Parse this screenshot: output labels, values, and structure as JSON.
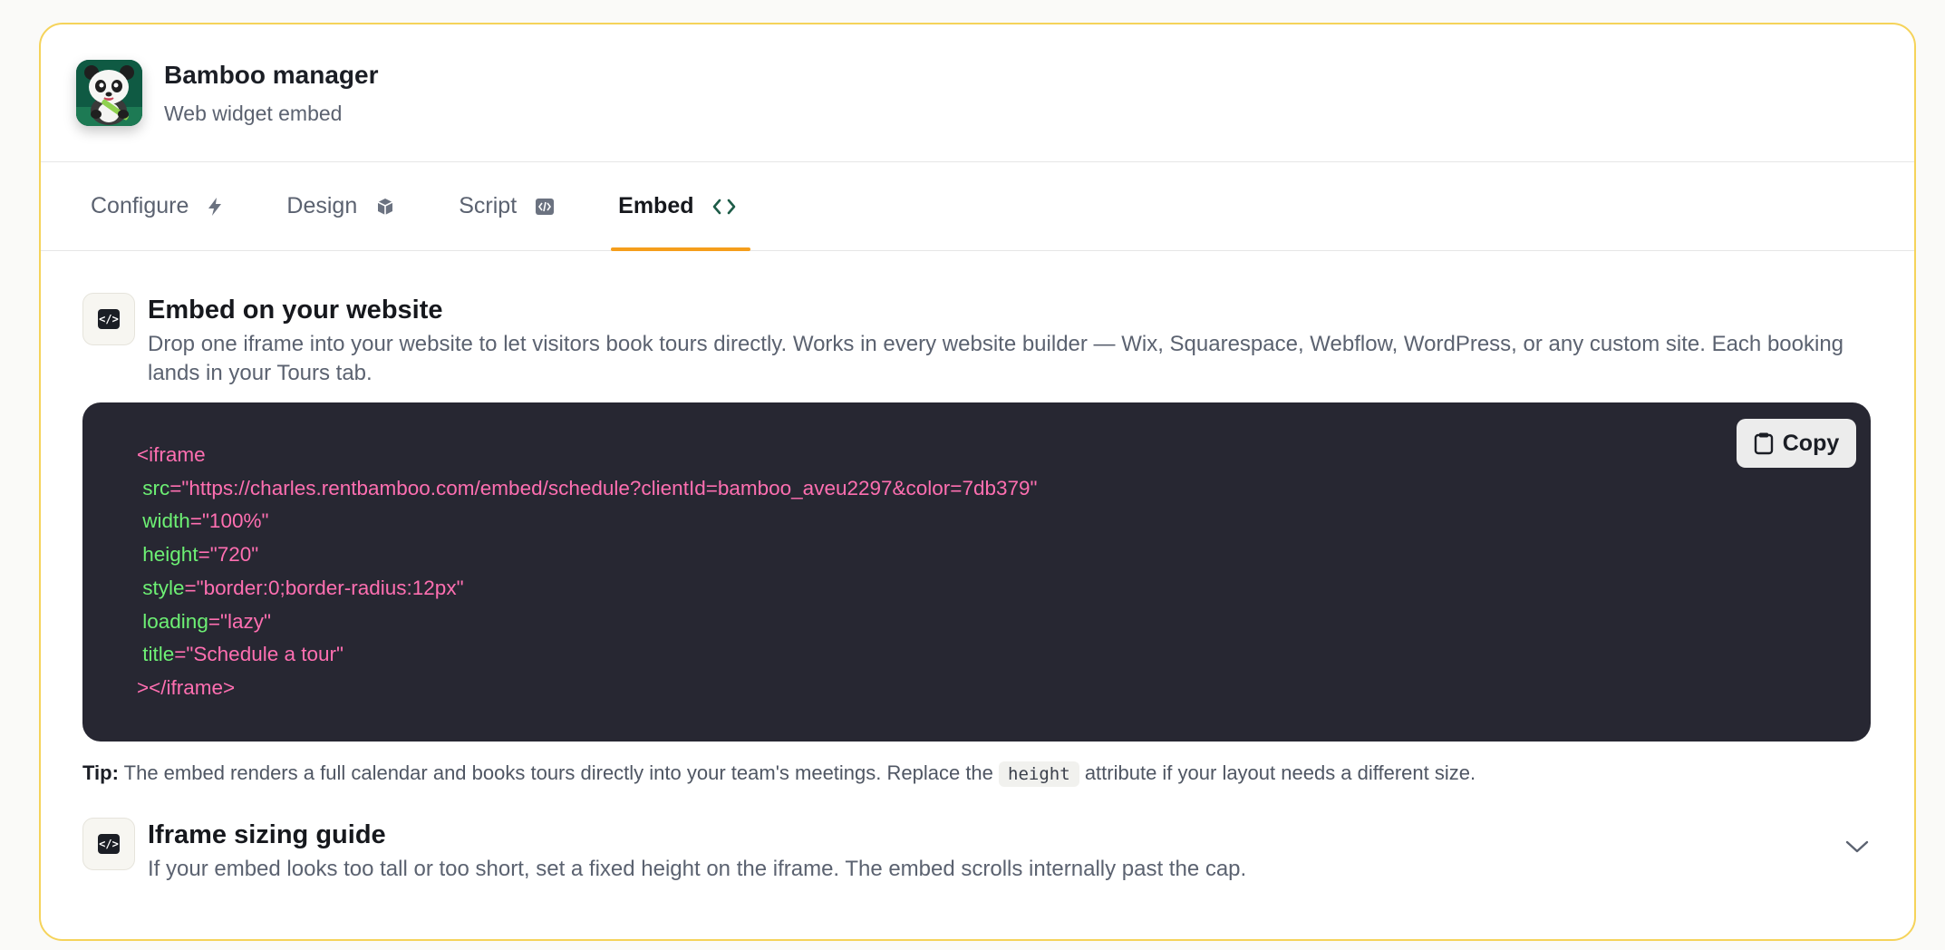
{
  "app": {
    "title": "Bamboo manager",
    "subtitle": "Web widget embed",
    "logo_icon": "panda-logo-icon"
  },
  "tabs": [
    {
      "label": "Configure",
      "icon": "bolt-icon",
      "active": false
    },
    {
      "label": "Design",
      "icon": "cube-icon",
      "active": false
    },
    {
      "label": "Script",
      "icon": "code-file-icon",
      "active": false
    },
    {
      "label": "Embed",
      "icon": "code-brackets-icon",
      "active": true
    }
  ],
  "embed": {
    "title": "Embed on your website",
    "description": "Drop one iframe into your website to let visitors book tours directly. Works in every website builder — Wix, Squarespace, Webflow, WordPress, or any custom site. Each booking lands in your Tours tab.",
    "copy_label": "Copy",
    "code": {
      "open_tag": "<iframe",
      "attrs": [
        {
          "name": "src",
          "value": "\"https://charles.rentbamboo.com/embed/schedule?clientId=bamboo_aveu2297&color=7db379\""
        },
        {
          "name": "width",
          "value": "\"100%\""
        },
        {
          "name": "height",
          "value": "\"720\""
        },
        {
          "name": "style",
          "value": "\"border:0;border-radius:12px\""
        },
        {
          "name": "loading",
          "value": "\"lazy\""
        },
        {
          "name": "title",
          "value": "\"Schedule a tour\""
        }
      ],
      "close_tag": "></iframe>"
    },
    "tip_label": "Tip:",
    "tip_text_before": "The embed renders a full calendar and books tours directly into your team's meetings. Replace the",
    "tip_code": "height",
    "tip_text_after": "attribute if your layout needs a different size."
  },
  "sizing": {
    "title": "Iframe sizing guide",
    "description": "If your embed looks too tall or too short, set a fixed height on the iframe. The embed scrolls internally past the cap."
  },
  "colors": {
    "accent": "#f59e1b",
    "card_border": "#f5d35a",
    "code_bg": "#272732",
    "code_tag": "#ff6fb1",
    "code_attr": "#6df074"
  }
}
